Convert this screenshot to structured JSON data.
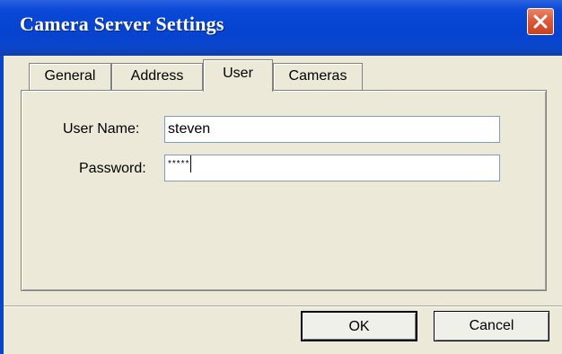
{
  "window": {
    "title": "Camera Server Settings"
  },
  "tabs": [
    {
      "label": "General",
      "active": false
    },
    {
      "label": "Address",
      "active": false
    },
    {
      "label": "User",
      "active": true
    },
    {
      "label": "Cameras",
      "active": false
    }
  ],
  "form": {
    "user_name_label": "User Name:",
    "user_name_value": "steven",
    "password_label": "Password:",
    "password_value": "*****"
  },
  "buttons": {
    "ok_label": "OK",
    "cancel_label": "Cancel"
  },
  "colors": {
    "titlebar": "#0543d0",
    "close_button": "#dc5a3a",
    "dialog_background": "#ece9d8"
  },
  "icons": {
    "close": "close-icon"
  }
}
